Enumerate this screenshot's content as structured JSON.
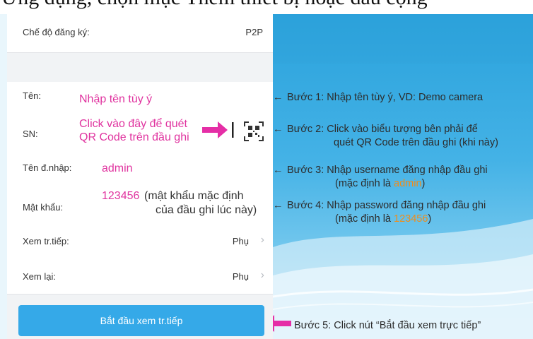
{
  "caption": {
    "text": "Ứng dụng, chọn mục Thêm thiết bị hoặc dấu cộng"
  },
  "phone": {
    "reg_mode_label": "Chế độ đăng ký:",
    "reg_mode_value": "P2P",
    "name_label": "Tên:",
    "name_hint": "Nhập tên tùy ý",
    "sn_label": "SN:",
    "sn_hint_line1": "Click vào đây để quét",
    "sn_hint_line2": "QR Code trên đầu ghi",
    "username_label": "Tên đ.nhập:",
    "username_value": "admin",
    "password_label": "Mật khẩu:",
    "password_value": "123456",
    "password_note_1": "(mật khẩu mặc định",
    "password_note_2": "của đầu ghi lúc này)",
    "live_label": "Xem tr.tiếp:",
    "live_value": "Phụ",
    "playback_label": "Xem lại:",
    "playback_value": "Phụ",
    "start_button": "Bắt đầu xem tr.tiếp"
  },
  "steps": {
    "step1": "Bước 1: Nhập tên tùy ý, VD: Demo camera",
    "step2_line1": "Bước 2: Click vào biểu tượng bên phải để",
    "step2_line2": "quét QR Code trên đầu ghi (khi này)",
    "step3_line1": "Bước 3: Nhập username đăng nhập đầu ghi",
    "step3_line2_pre": "(mặc định là ",
    "step3_line2_value": "admin",
    "step3_line2_post": ")",
    "step4_line1": "Bước 4: Nhập password đăng nhập đầu ghi",
    "step4_line2_pre": "(mặc định là ",
    "step4_line2_value": "123456",
    "step4_line2_post": ")",
    "step5": "Bước 5: Click nút “Bắt đầu xem trực tiếp”",
    "arrow_glyph": "←"
  },
  "colors": {
    "hint_pink": "#e0339f",
    "button_blue": "#35a9e8",
    "highlight_orange": "#f08c1a"
  },
  "icons": {
    "qr": "qr-code-icon",
    "chevron": "chevron-right-icon",
    "pointer": "pink-arrow-icon"
  }
}
